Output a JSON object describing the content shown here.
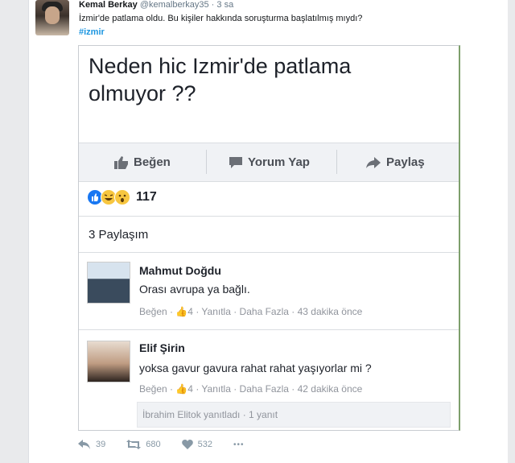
{
  "tweet": {
    "author_name": "Kemal Berkay",
    "author_handle": "@kemalberkay35",
    "time": "· 3 sa",
    "text": "İzmir'de patlama oldu. Bu kişiler hakkında soruşturma başlatılmış mıydı?",
    "hashtag": "#izmir",
    "footer": {
      "reply_count": "39",
      "retweet_count": "680",
      "like_count": "532",
      "more": "•••"
    }
  },
  "fb_post": {
    "title_line1": "Neden hic Izmir'de patlama",
    "title_line2": "olmuyor ??",
    "actions": {
      "like": "Beğen",
      "comment": "Yorum Yap",
      "share": "Paylaş"
    },
    "reaction_count": "117",
    "shares": "3 Paylaşım",
    "comments": [
      {
        "name": "Mahmut Doğdu",
        "text": "Orası avrupa ya bağlı.",
        "meta": "Beğen · 👍4 · Yanıtla · Daha Fazla · 43 dakika önce"
      },
      {
        "name": "Elif Şirin",
        "text": "yoksa gavur gavura rahat rahat yaşıyorlar mi ?",
        "meta": "Beğen · 👍4 · Yanıtla · Daha Fazla · 42 dakika önce"
      }
    ],
    "reply_preview": "İbrahim Elitok yanıtladı · 1 yanıt"
  },
  "colors": {
    "twitter_link": "#1b95e0",
    "fb_like_blue": "#1877f2",
    "fb_text": "#1d2129",
    "muted": "#90949c"
  },
  "icons": [
    "thumbs-up-icon",
    "comment-icon",
    "share-arrow-icon",
    "reply-icon",
    "retweet-icon",
    "heart-icon",
    "more-icon"
  ]
}
